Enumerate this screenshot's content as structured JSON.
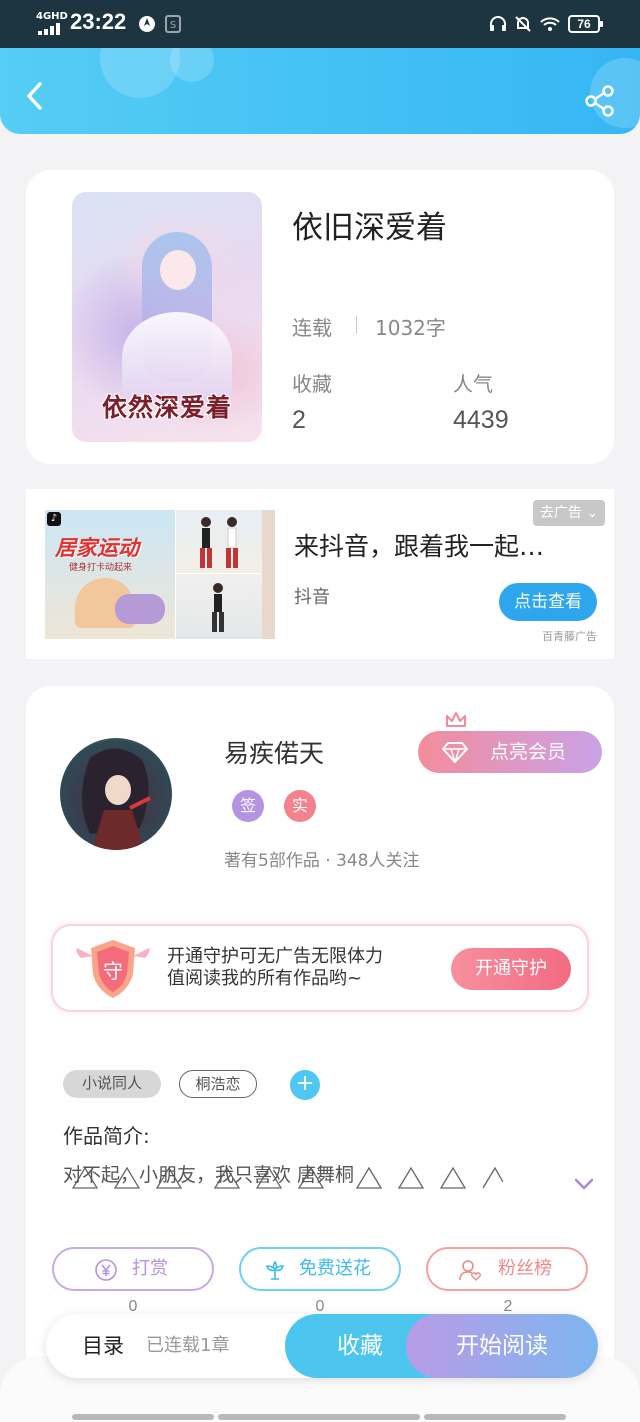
{
  "status_bar": {
    "network": "4GHD",
    "time": "23:22",
    "battery": "76"
  },
  "header": {
    "back_icon": "chevron-left-icon",
    "share_icon": "share-icon"
  },
  "book": {
    "cover_title": "依然深爱着",
    "title": "依旧深爱着",
    "status": "连载",
    "words": "1032字",
    "stats": [
      {
        "label": "收藏",
        "value": "2"
      },
      {
        "label": "人气",
        "value": "4439"
      }
    ]
  },
  "ad": {
    "image_title": "居家运动",
    "image_subtitle": "健身打卡动起来",
    "title": "来抖音，跟着我一起…",
    "source": "抖音",
    "close_label": "去广告",
    "cta": "点击查看",
    "brand": "百青藤广告"
  },
  "author": {
    "name": "易疾偌天",
    "badges": [
      {
        "label": "签",
        "color": "#b692e2"
      },
      {
        "label": "实",
        "color": "#f2828e"
      }
    ],
    "meta": "著有5部作品 · 348人关注",
    "vip_label": "点亮会员"
  },
  "guard": {
    "shield_label": "守",
    "line1": "开通守护可无广告无限体力",
    "line2": "值阅读我的所有作品哟~",
    "button": "开通守护"
  },
  "tags": [
    "小说同人",
    "桐浩恋"
  ],
  "intro": {
    "title": "作品简介:",
    "text": "对不起，小朋友，我只喜欢 唐舞桐"
  },
  "actions": [
    {
      "label": "打赏",
      "count": "0",
      "color": "#b692e2",
      "icon": "yen-icon"
    },
    {
      "label": "免费送花",
      "count": "0",
      "color": "#4dc6ef",
      "icon": "flower-icon"
    },
    {
      "label": "粉丝榜",
      "count": "2",
      "color": "#f08a8a",
      "icon": "fan-icon"
    }
  ],
  "bottom_bar": {
    "toc": "目录",
    "chapters": "已连载1章",
    "favorite": "收藏",
    "read": "开始阅读"
  }
}
